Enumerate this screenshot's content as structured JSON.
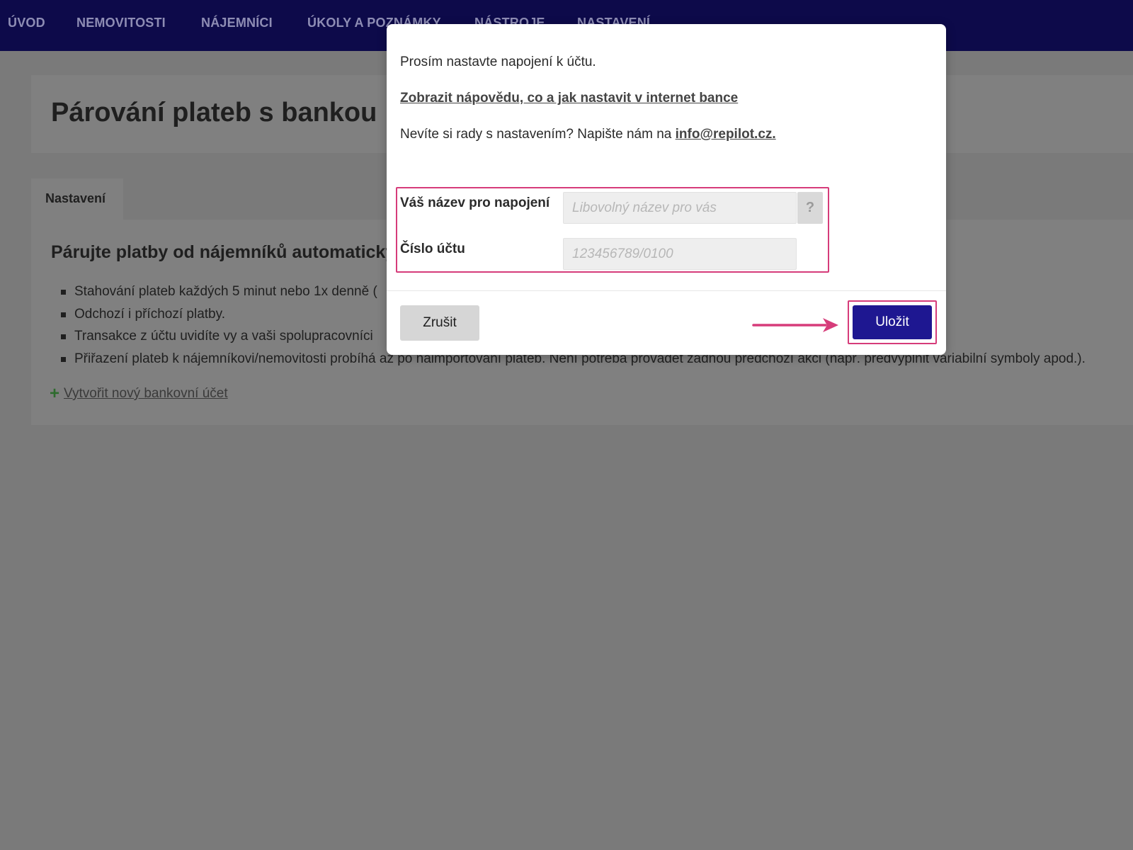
{
  "nav": {
    "items": [
      "ÚVOD",
      "NEMOVITOSTI",
      "NÁJEMNÍCI",
      "ÚKOLY A POZNÁMKY",
      "NÁSTROJE",
      "NASTAVENÍ"
    ]
  },
  "page": {
    "title": "Párování plateb s bankou",
    "tab_label": "Nastavení",
    "subtitle": "Párujte platby od nájemníků automaticky",
    "bullets": [
      "Stahování plateb každých 5 minut nebo 1x denně (",
      "Odchozí i příchozí platby.",
      "Transakce z účtu uvidíte vy a vaši spolupracovníci",
      "Přiřazení plateb k nájemníkovi/nemovitosti probíhá až po naimportování plateb. Není potřeba provádět žádnou předchozí akci (např. předvyplnit variabilní symboly apod.)."
    ],
    "new_account_link": "Vytvořit nový bankovní účet"
  },
  "modal": {
    "intro": "Prosím nastavte napojení k účtu.",
    "help_link": "Zobrazit nápovědu, co a jak nastavit v internet bance",
    "contact_prefix": "Nevíte si rady s nastavením? Napište nám na ",
    "contact_email": "info@repilot.cz.",
    "fields": {
      "name_label": "Váš název pro napojení",
      "name_placeholder": "Libovolný název pro vás",
      "name_value": "",
      "account_label": "Číslo účtu",
      "account_placeholder": "123456789/0100",
      "account_value": ""
    },
    "help_button": "?",
    "cancel_label": "Zrušit",
    "save_label": "Uložit"
  },
  "colors": {
    "nav_bg": "#0d0a4a",
    "primary_button": "#1e1791",
    "highlight": "#d63c7a",
    "overlay_bg": "#7a7a7a"
  },
  "icons": {
    "add": "plus-icon",
    "help": "question-icon",
    "annotation": "arrow-right-icon"
  }
}
